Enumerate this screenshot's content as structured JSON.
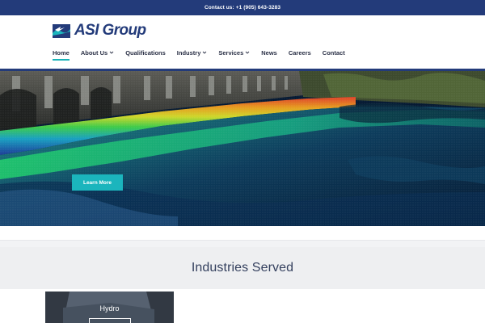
{
  "topbar": {
    "contact_text": "Contact us: +1 (905) 643-3283"
  },
  "logo": {
    "text": "ASI Group",
    "brand_color": "#233b7a",
    "icon": "asi-wave-logo-icon"
  },
  "nav": {
    "items": [
      {
        "label": "Home",
        "active": true,
        "has_dropdown": false
      },
      {
        "label": "About Us",
        "active": false,
        "has_dropdown": true
      },
      {
        "label": "Qualifications",
        "active": false,
        "has_dropdown": false
      },
      {
        "label": "Industry",
        "active": false,
        "has_dropdown": true
      },
      {
        "label": "Services",
        "active": false,
        "has_dropdown": true
      },
      {
        "label": "News",
        "active": false,
        "has_dropdown": false
      },
      {
        "label": "Careers",
        "active": false,
        "has_dropdown": false
      },
      {
        "label": "Contact",
        "active": false,
        "has_dropdown": false
      }
    ],
    "active_underline_color": "#18b3b8"
  },
  "hero": {
    "button_label": "Learn More",
    "button_color": "#1bb5bd"
  },
  "industries": {
    "heading": "Industries Served"
  },
  "cards": [
    {
      "title": "Hydro"
    }
  ]
}
